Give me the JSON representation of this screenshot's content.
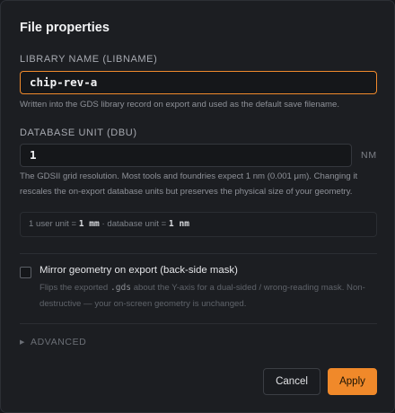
{
  "dialog": {
    "title": "File properties"
  },
  "libname": {
    "label": "LIBRARY NAME (LIBNAME)",
    "value": "chip-rev-a",
    "help": "Written into the GDS library record on export and used as the default save filename."
  },
  "dbu": {
    "label": "DATABASE UNIT (DBU)",
    "value": "1",
    "unit": "NM",
    "help": "The GDSII grid resolution. Most tools and foundries expect 1 nm (0.001 μm). Changing it rescales the on-export database units but preserves the physical size of your geometry."
  },
  "conversion": {
    "prefix": "1 user unit = ",
    "user_value": "1 mm",
    "middle": " · database unit = ",
    "db_value": "1 nm"
  },
  "mirror": {
    "label": "Mirror geometry on export (back-side mask)",
    "checked": false,
    "help_prefix": "Flips the exported ",
    "help_code": ".gds",
    "help_suffix": " about the Y-axis for a dual-sided / wrong-reading mask. Non-destructive — your on-screen geometry is unchanged."
  },
  "advanced": {
    "label": "ADVANCED",
    "icon": "triangle-right-icon"
  },
  "footer": {
    "cancel_label": "Cancel",
    "apply_label": "Apply"
  },
  "colors": {
    "accent": "#f0892a",
    "background": "#1c1e22"
  }
}
